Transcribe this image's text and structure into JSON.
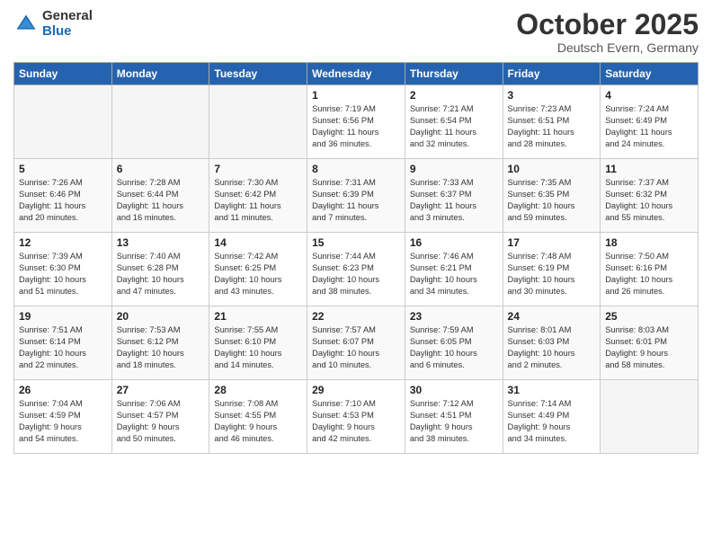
{
  "logo": {
    "general": "General",
    "blue": "Blue"
  },
  "header": {
    "month": "October 2025",
    "location": "Deutsch Evern, Germany"
  },
  "days_of_week": [
    "Sunday",
    "Monday",
    "Tuesday",
    "Wednesday",
    "Thursday",
    "Friday",
    "Saturday"
  ],
  "weeks": [
    [
      {
        "day": "",
        "info": ""
      },
      {
        "day": "",
        "info": ""
      },
      {
        "day": "",
        "info": ""
      },
      {
        "day": "1",
        "info": "Sunrise: 7:19 AM\nSunset: 6:56 PM\nDaylight: 11 hours\nand 36 minutes."
      },
      {
        "day": "2",
        "info": "Sunrise: 7:21 AM\nSunset: 6:54 PM\nDaylight: 11 hours\nand 32 minutes."
      },
      {
        "day": "3",
        "info": "Sunrise: 7:23 AM\nSunset: 6:51 PM\nDaylight: 11 hours\nand 28 minutes."
      },
      {
        "day": "4",
        "info": "Sunrise: 7:24 AM\nSunset: 6:49 PM\nDaylight: 11 hours\nand 24 minutes."
      }
    ],
    [
      {
        "day": "5",
        "info": "Sunrise: 7:26 AM\nSunset: 6:46 PM\nDaylight: 11 hours\nand 20 minutes."
      },
      {
        "day": "6",
        "info": "Sunrise: 7:28 AM\nSunset: 6:44 PM\nDaylight: 11 hours\nand 16 minutes."
      },
      {
        "day": "7",
        "info": "Sunrise: 7:30 AM\nSunset: 6:42 PM\nDaylight: 11 hours\nand 11 minutes."
      },
      {
        "day": "8",
        "info": "Sunrise: 7:31 AM\nSunset: 6:39 PM\nDaylight: 11 hours\nand 7 minutes."
      },
      {
        "day": "9",
        "info": "Sunrise: 7:33 AM\nSunset: 6:37 PM\nDaylight: 11 hours\nand 3 minutes."
      },
      {
        "day": "10",
        "info": "Sunrise: 7:35 AM\nSunset: 6:35 PM\nDaylight: 10 hours\nand 59 minutes."
      },
      {
        "day": "11",
        "info": "Sunrise: 7:37 AM\nSunset: 6:32 PM\nDaylight: 10 hours\nand 55 minutes."
      }
    ],
    [
      {
        "day": "12",
        "info": "Sunrise: 7:39 AM\nSunset: 6:30 PM\nDaylight: 10 hours\nand 51 minutes."
      },
      {
        "day": "13",
        "info": "Sunrise: 7:40 AM\nSunset: 6:28 PM\nDaylight: 10 hours\nand 47 minutes."
      },
      {
        "day": "14",
        "info": "Sunrise: 7:42 AM\nSunset: 6:25 PM\nDaylight: 10 hours\nand 43 minutes."
      },
      {
        "day": "15",
        "info": "Sunrise: 7:44 AM\nSunset: 6:23 PM\nDaylight: 10 hours\nand 38 minutes."
      },
      {
        "day": "16",
        "info": "Sunrise: 7:46 AM\nSunset: 6:21 PM\nDaylight: 10 hours\nand 34 minutes."
      },
      {
        "day": "17",
        "info": "Sunrise: 7:48 AM\nSunset: 6:19 PM\nDaylight: 10 hours\nand 30 minutes."
      },
      {
        "day": "18",
        "info": "Sunrise: 7:50 AM\nSunset: 6:16 PM\nDaylight: 10 hours\nand 26 minutes."
      }
    ],
    [
      {
        "day": "19",
        "info": "Sunrise: 7:51 AM\nSunset: 6:14 PM\nDaylight: 10 hours\nand 22 minutes."
      },
      {
        "day": "20",
        "info": "Sunrise: 7:53 AM\nSunset: 6:12 PM\nDaylight: 10 hours\nand 18 minutes."
      },
      {
        "day": "21",
        "info": "Sunrise: 7:55 AM\nSunset: 6:10 PM\nDaylight: 10 hours\nand 14 minutes."
      },
      {
        "day": "22",
        "info": "Sunrise: 7:57 AM\nSunset: 6:07 PM\nDaylight: 10 hours\nand 10 minutes."
      },
      {
        "day": "23",
        "info": "Sunrise: 7:59 AM\nSunset: 6:05 PM\nDaylight: 10 hours\nand 6 minutes."
      },
      {
        "day": "24",
        "info": "Sunrise: 8:01 AM\nSunset: 6:03 PM\nDaylight: 10 hours\nand 2 minutes."
      },
      {
        "day": "25",
        "info": "Sunrise: 8:03 AM\nSunset: 6:01 PM\nDaylight: 9 hours\nand 58 minutes."
      }
    ],
    [
      {
        "day": "26",
        "info": "Sunrise: 7:04 AM\nSunset: 4:59 PM\nDaylight: 9 hours\nand 54 minutes."
      },
      {
        "day": "27",
        "info": "Sunrise: 7:06 AM\nSunset: 4:57 PM\nDaylight: 9 hours\nand 50 minutes."
      },
      {
        "day": "28",
        "info": "Sunrise: 7:08 AM\nSunset: 4:55 PM\nDaylight: 9 hours\nand 46 minutes."
      },
      {
        "day": "29",
        "info": "Sunrise: 7:10 AM\nSunset: 4:53 PM\nDaylight: 9 hours\nand 42 minutes."
      },
      {
        "day": "30",
        "info": "Sunrise: 7:12 AM\nSunset: 4:51 PM\nDaylight: 9 hours\nand 38 minutes."
      },
      {
        "day": "31",
        "info": "Sunrise: 7:14 AM\nSunset: 4:49 PM\nDaylight: 9 hours\nand 34 minutes."
      },
      {
        "day": "",
        "info": ""
      }
    ]
  ]
}
